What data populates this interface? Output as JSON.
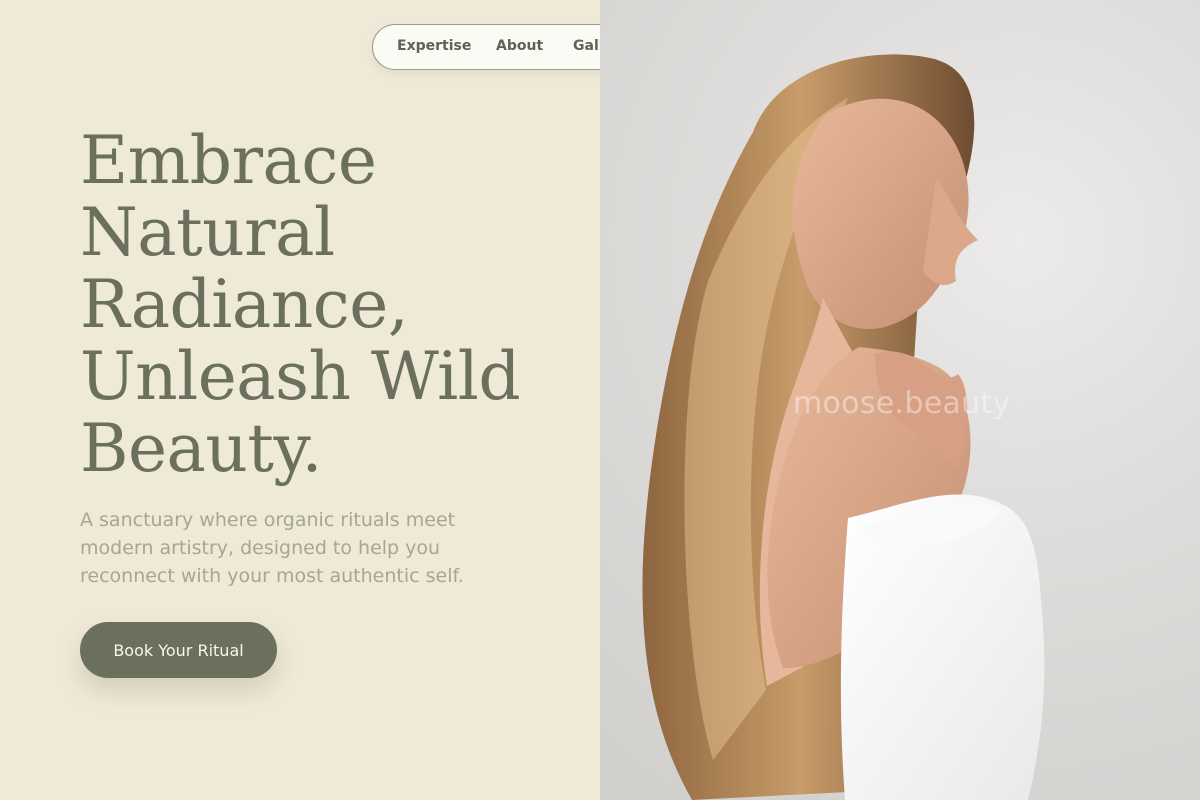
{
  "nav": {
    "items": [
      {
        "label": "Expertise"
      },
      {
        "label": "About"
      },
      {
        "label": "Gall"
      }
    ]
  },
  "hero": {
    "title": "Embrace Natural Radiance, Unleash Wild Beauty.",
    "subtitle": "A sanctuary where organic rituals meet modern artistry, designed to help you reconnect with your most authentic self.",
    "cta_label": "Book Your Ritual",
    "image_watermark": "moose.beauty"
  },
  "colors": {
    "background": "#efe9d7",
    "accent": "#6b705c",
    "muted_text": "#a6a791",
    "nav_background": "#fbfaf5"
  }
}
